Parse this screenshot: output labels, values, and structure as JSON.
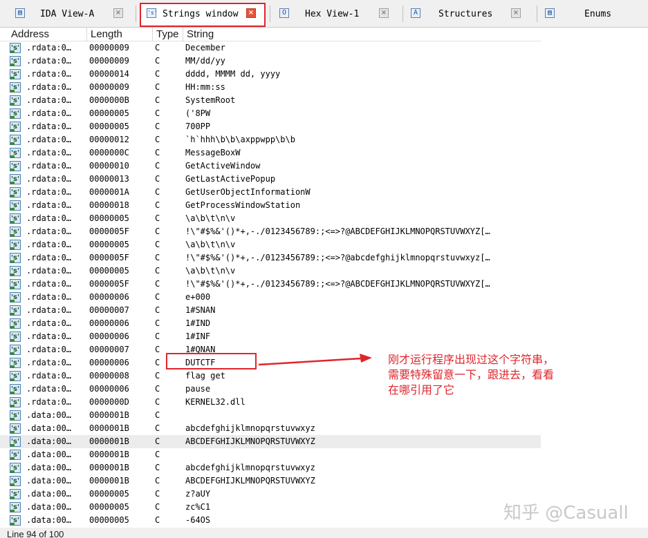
{
  "tabs": [
    {
      "label": "IDA View-A",
      "icon": "ida-view-icon",
      "glyph": "▤",
      "active": false
    },
    {
      "label": "Strings window",
      "icon": "strings-icon",
      "glyph": "'s'",
      "active": true
    },
    {
      "label": "Hex View-1",
      "icon": "hex-view-icon",
      "glyph": "O",
      "active": false
    },
    {
      "label": "Structures",
      "icon": "structures-icon",
      "glyph": "A",
      "active": false
    },
    {
      "label": "Enums",
      "icon": "enums-icon",
      "glyph": "▤",
      "active": false
    }
  ],
  "columns": {
    "address": "Address",
    "length": "Length",
    "type": "Type",
    "string": "String"
  },
  "rows": [
    {
      "address": ".rdata:0…",
      "length": "00000009",
      "type": "C",
      "string": "December"
    },
    {
      "address": ".rdata:0…",
      "length": "00000009",
      "type": "C",
      "string": "MM/dd/yy"
    },
    {
      "address": ".rdata:0…",
      "length": "00000014",
      "type": "C",
      "string": "dddd, MMMM dd, yyyy"
    },
    {
      "address": ".rdata:0…",
      "length": "00000009",
      "type": "C",
      "string": "HH:mm:ss"
    },
    {
      "address": ".rdata:0…",
      "length": "0000000B",
      "type": "C",
      "string": "SystemRoot"
    },
    {
      "address": ".rdata:0…",
      "length": "00000005",
      "type": "C",
      "string": "('8PW"
    },
    {
      "address": ".rdata:0…",
      "length": "00000005",
      "type": "C",
      "string": "700PP"
    },
    {
      "address": ".rdata:0…",
      "length": "00000012",
      "type": "C",
      "string": "`h`hhh\\b\\b\\axppwpp\\b\\b"
    },
    {
      "address": ".rdata:0…",
      "length": "0000000C",
      "type": "C",
      "string": "MessageBoxW"
    },
    {
      "address": ".rdata:0…",
      "length": "00000010",
      "type": "C",
      "string": "GetActiveWindow"
    },
    {
      "address": ".rdata:0…",
      "length": "00000013",
      "type": "C",
      "string": "GetLastActivePopup"
    },
    {
      "address": ".rdata:0…",
      "length": "0000001A",
      "type": "C",
      "string": "GetUserObjectInformationW"
    },
    {
      "address": ".rdata:0…",
      "length": "00000018",
      "type": "C",
      "string": "GetProcessWindowStation"
    },
    {
      "address": ".rdata:0…",
      "length": "00000005",
      "type": "C",
      "string": "\\a\\b\\t\\n\\v"
    },
    {
      "address": ".rdata:0…",
      "length": "0000005F",
      "type": "C",
      "string": " !\\\"#$%&'()*+,-./0123456789:;<=>?@ABCDEFGHIJKLMNOPQRSTUVWXYZ[…"
    },
    {
      "address": ".rdata:0…",
      "length": "00000005",
      "type": "C",
      "string": "\\a\\b\\t\\n\\v"
    },
    {
      "address": ".rdata:0…",
      "length": "0000005F",
      "type": "C",
      "string": " !\\\"#$%&'()*+,-./0123456789:;<=>?@abcdefghijklmnopqrstuvwxyz[…"
    },
    {
      "address": ".rdata:0…",
      "length": "00000005",
      "type": "C",
      "string": "\\a\\b\\t\\n\\v"
    },
    {
      "address": ".rdata:0…",
      "length": "0000005F",
      "type": "C",
      "string": " !\\\"#$%&'()*+,-./0123456789:;<=>?@ABCDEFGHIJKLMNOPQRSTUVWXYZ[…"
    },
    {
      "address": ".rdata:0…",
      "length": "00000006",
      "type": "C",
      "string": "e+000"
    },
    {
      "address": ".rdata:0…",
      "length": "00000007",
      "type": "C",
      "string": "1#SNAN"
    },
    {
      "address": ".rdata:0…",
      "length": "00000006",
      "type": "C",
      "string": "1#IND"
    },
    {
      "address": ".rdata:0…",
      "length": "00000006",
      "type": "C",
      "string": "1#INF"
    },
    {
      "address": ".rdata:0…",
      "length": "00000007",
      "type": "C",
      "string": "1#QNAN"
    },
    {
      "address": ".rdata:0…",
      "length": "00000006",
      "type": "C",
      "string": "DUTCTF"
    },
    {
      "address": ".rdata:0…",
      "length": "00000008",
      "type": "C",
      "string": "flag get"
    },
    {
      "address": ".rdata:0…",
      "length": "00000006",
      "type": "C",
      "string": "pause"
    },
    {
      "address": ".rdata:0…",
      "length": "0000000D",
      "type": "C",
      "string": "KERNEL32.dll"
    },
    {
      "address": ".data:00…",
      "length": "0000001B",
      "type": "C",
      "string": ""
    },
    {
      "address": ".data:00…",
      "length": "0000001B",
      "type": "C",
      "string": "abcdefghijklmnopqrstuvwxyz"
    },
    {
      "address": ".data:00…",
      "length": "0000001B",
      "type": "C",
      "string": "ABCDEFGHIJKLMNOPQRSTUVWXYZ",
      "selected": true
    },
    {
      "address": ".data:00…",
      "length": "0000001B",
      "type": "C",
      "string": ""
    },
    {
      "address": ".data:00…",
      "length": "0000001B",
      "type": "C",
      "string": "abcdefghijklmnopqrstuvwxyz"
    },
    {
      "address": ".data:00…",
      "length": "0000001B",
      "type": "C",
      "string": "ABCDEFGHIJKLMNOPQRSTUVWXYZ"
    },
    {
      "address": ".data:00…",
      "length": "00000005",
      "type": "C",
      "string": "z?aUY"
    },
    {
      "address": ".data:00…",
      "length": "00000005",
      "type": "C",
      "string": "zc%C1"
    },
    {
      "address": ".data:00…",
      "length": "00000005",
      "type": "C",
      "string": "-64OS"
    }
  ],
  "row_icon_glyph": "'s'",
  "status": {
    "text": "Line 94 of 100"
  },
  "annotation": {
    "text": "刚才运行程序出现过这个字符串，\n需要特殊留意一下，跟进去，看看\n在哪引用了它",
    "color": "#e0242b"
  },
  "watermark": {
    "text": "知乎 @Casuall"
  }
}
